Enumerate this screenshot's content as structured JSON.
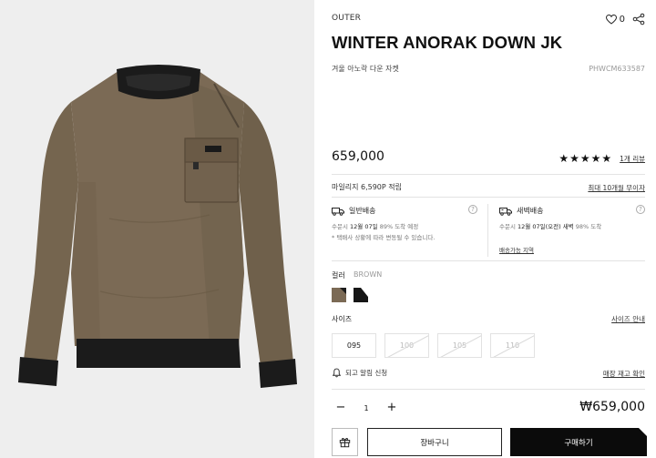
{
  "product": {
    "category": "OUTER",
    "title": "WINTER ANORAK DOWN JK",
    "subtitle": "겨울 아노락 다운 자켓",
    "code": "PHWCM633587",
    "price": "659,000",
    "rating_stars": "★★★★★",
    "rating_value": 5,
    "review_link": "1개 리뷰",
    "wishlist_count": "0"
  },
  "mileage": {
    "text": "마일리지 6,590P 적립",
    "benefit_link": "최대 10개월 무이자"
  },
  "shipping": {
    "standard": {
      "title": "일반배송",
      "lead": "수문시",
      "date": "12월 07일",
      "rate": "89% 도착 예정",
      "note": "* 택배사 상황에 따라 변동될 수 있습니다.",
      "help": "?"
    },
    "dawn": {
      "title": "새벽배송",
      "lead": "수문시",
      "date": "12월 07일(오전) 새벽",
      "rate": "98% 도착",
      "area_link": "배송가능 지역",
      "help": "?"
    }
  },
  "color": {
    "label": "컬러",
    "value": "BROWN",
    "swatches": [
      {
        "name": "brown",
        "main": "#7b6a55",
        "accent": "#1c1c1c"
      },
      {
        "name": "black",
        "main": "#161616",
        "accent": "#ffffff"
      }
    ]
  },
  "size": {
    "label": "사이즈",
    "guide_link": "사이즈 안내",
    "options": [
      {
        "label": "095",
        "available": true
      },
      {
        "label": "100",
        "available": false
      },
      {
        "label": "105",
        "available": false
      },
      {
        "label": "110",
        "available": false
      }
    ]
  },
  "restock": {
    "label": "되고 알림 신청",
    "link": "매장 재고 확인"
  },
  "quantity": {
    "minus": "−",
    "value": "1",
    "plus": "+"
  },
  "total": "₩659,000",
  "buttons": {
    "cart": "장바구니",
    "buy": "구매하기"
  },
  "colors": {
    "garment": "#7a6a55",
    "rib": "#1b1b1b",
    "background": "#eeeeee"
  }
}
